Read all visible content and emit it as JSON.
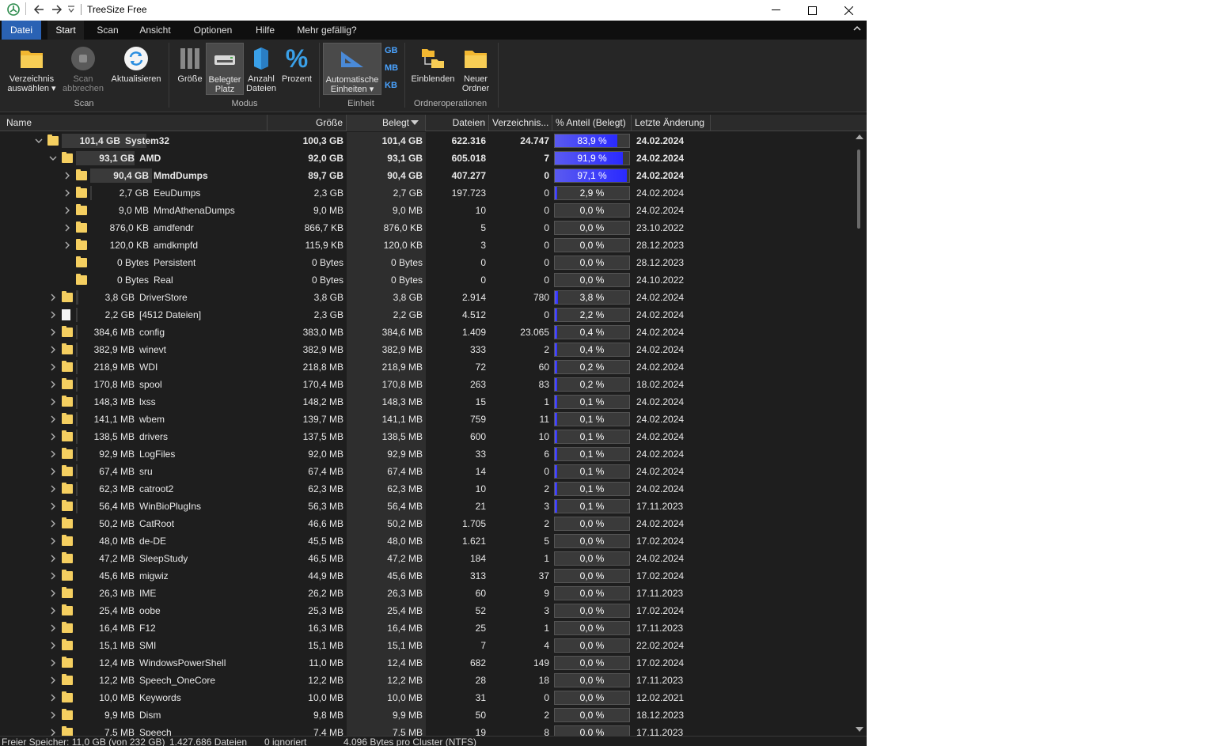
{
  "window": {
    "title": "TreeSize Free"
  },
  "tabs": [
    {
      "label": "Datei"
    },
    {
      "label": "Start"
    },
    {
      "label": "Scan"
    },
    {
      "label": "Ansicht"
    },
    {
      "label": "Optionen"
    },
    {
      "label": "Hilfe"
    },
    {
      "label": "Mehr gefällig?"
    }
  ],
  "ribbon": {
    "scan_group": {
      "label": "Scan",
      "select_dir": "Verzeichnis auswählen ▾",
      "select_dir_l1": "Verzeichnis",
      "select_dir_l2": "auswählen ▾",
      "abort_l1": "Scan",
      "abort_l2": "abbrechen",
      "refresh": "Aktualisieren"
    },
    "mode_group": {
      "label": "Modus",
      "size": "Größe",
      "used_l1": "Belegter",
      "used_l2": "Platz",
      "count_l1": "Anzahl",
      "count_l2": "Dateien",
      "percent": "Prozent"
    },
    "unit_group": {
      "label": "Einheit",
      "auto_l1": "Automatische",
      "auto_l2": "Einheiten ▾",
      "gb": "GB",
      "mb": "MB",
      "kb": "KB"
    },
    "folder_group": {
      "label": "Ordneroperationen",
      "show": "Einblenden",
      "new_l1": "Neuer",
      "new_l2": "Ordner"
    }
  },
  "columns": {
    "name": "Name",
    "size": "Größe",
    "used": "Belegt",
    "files": "Dateien",
    "dirs": "Verzeichnis...",
    "pct": "% Anteil (Belegt)",
    "modified": "Letzte Änderung"
  },
  "accent_color": "#2a62b4",
  "bar_color": "#3a3aff",
  "rows": [
    {
      "level": 0,
      "exp": "open",
      "type": "folder",
      "sz": "101,4 GB",
      "name": "System32",
      "size": "100,3 GB",
      "used": "101,4 GB",
      "files": "622.316",
      "dirs": "24.747",
      "pct": "83,9 %",
      "pv": 83.9,
      "date": "24.02.2024",
      "bold": true
    },
    {
      "level": 1,
      "exp": "open",
      "type": "folder",
      "sz": "93,1 GB",
      "name": "AMD",
      "size": "92,0 GB",
      "used": "93,1 GB",
      "files": "605.018",
      "dirs": "7",
      "pct": "91,9 %",
      "pv": 91.9,
      "date": "24.02.2024",
      "bold": true
    },
    {
      "level": 2,
      "exp": "closed",
      "type": "folder",
      "sz": "90,4 GB",
      "name": "MmdDumps",
      "size": "89,7 GB",
      "used": "90,4 GB",
      "files": "407.277",
      "dirs": "0",
      "pct": "97,1 %",
      "pv": 97.1,
      "date": "24.02.2024",
      "bold": true
    },
    {
      "level": 2,
      "exp": "closed",
      "type": "folder",
      "sz": "2,7 GB",
      "name": "EeuDumps",
      "size": "2,3 GB",
      "used": "2,7 GB",
      "files": "197.723",
      "dirs": "0",
      "pct": "2,9 %",
      "pv": 2.9,
      "date": "24.02.2024"
    },
    {
      "level": 2,
      "exp": "closed",
      "type": "folder",
      "sz": "9,0 MB",
      "name": "MmdAthenaDumps",
      "size": "9,0 MB",
      "used": "9,0 MB",
      "files": "10",
      "dirs": "0",
      "pct": "0,0 %",
      "pv": 0,
      "date": "24.02.2024"
    },
    {
      "level": 2,
      "exp": "closed",
      "type": "folder",
      "sz": "876,0 KB",
      "name": "amdfendr",
      "size": "866,7 KB",
      "used": "876,0 KB",
      "files": "5",
      "dirs": "0",
      "pct": "0,0 %",
      "pv": 0,
      "date": "23.10.2022"
    },
    {
      "level": 2,
      "exp": "closed",
      "type": "folder",
      "sz": "120,0 KB",
      "name": "amdkmpfd",
      "size": "115,9 KB",
      "used": "120,0 KB",
      "files": "3",
      "dirs": "0",
      "pct": "0,0 %",
      "pv": 0,
      "date": "28.12.2023"
    },
    {
      "level": 2,
      "exp": "none",
      "type": "folder",
      "sz": "0 Bytes",
      "name": "Persistent",
      "size": "0 Bytes",
      "used": "0 Bytes",
      "files": "0",
      "dirs": "0",
      "pct": "0,0 %",
      "pv": 0,
      "date": "28.12.2023"
    },
    {
      "level": 2,
      "exp": "none",
      "type": "folder",
      "sz": "0 Bytes",
      "name": "Real",
      "size": "0 Bytes",
      "used": "0 Bytes",
      "files": "0",
      "dirs": "0",
      "pct": "0,0 %",
      "pv": 0,
      "date": "24.10.2022"
    },
    {
      "level": 1,
      "exp": "closed",
      "type": "folder",
      "sz": "3,8 GB",
      "name": "DriverStore",
      "size": "3,8 GB",
      "used": "3,8 GB",
      "files": "2.914",
      "dirs": "780",
      "pct": "3,8 %",
      "pv": 3.8,
      "date": "24.02.2024"
    },
    {
      "level": 1,
      "exp": "closed",
      "type": "file",
      "sz": "2,2 GB",
      "name": "[4512 Dateien]",
      "size": "2,3 GB",
      "used": "2,2 GB",
      "files": "4.512",
      "dirs": "0",
      "pct": "2,2 %",
      "pv": 2.2,
      "date": "24.02.2024"
    },
    {
      "level": 1,
      "exp": "closed",
      "type": "folder",
      "sz": "384,6 MB",
      "name": "config",
      "size": "383,0 MB",
      "used": "384,6 MB",
      "files": "1.409",
      "dirs": "23.065",
      "pct": "0,4 %",
      "pv": 0.4,
      "date": "24.02.2024"
    },
    {
      "level": 1,
      "exp": "closed",
      "type": "folder",
      "sz": "382,9 MB",
      "name": "winevt",
      "size": "382,9 MB",
      "used": "382,9 MB",
      "files": "333",
      "dirs": "2",
      "pct": "0,4 %",
      "pv": 0.4,
      "date": "24.02.2024"
    },
    {
      "level": 1,
      "exp": "closed",
      "type": "folder",
      "sz": "218,9 MB",
      "name": "WDI",
      "size": "218,8 MB",
      "used": "218,9 MB",
      "files": "72",
      "dirs": "60",
      "pct": "0,2 %",
      "pv": 0.2,
      "date": "24.02.2024"
    },
    {
      "level": 1,
      "exp": "closed",
      "type": "folder",
      "sz": "170,8 MB",
      "name": "spool",
      "size": "170,4 MB",
      "used": "170,8 MB",
      "files": "263",
      "dirs": "83",
      "pct": "0,2 %",
      "pv": 0.2,
      "date": "18.02.2024"
    },
    {
      "level": 1,
      "exp": "closed",
      "type": "folder",
      "sz": "148,3 MB",
      "name": "lxss",
      "size": "148,2 MB",
      "used": "148,3 MB",
      "files": "15",
      "dirs": "1",
      "pct": "0,1 %",
      "pv": 0.1,
      "date": "24.02.2024"
    },
    {
      "level": 1,
      "exp": "closed",
      "type": "folder",
      "sz": "141,1 MB",
      "name": "wbem",
      "size": "139,7 MB",
      "used": "141,1 MB",
      "files": "759",
      "dirs": "11",
      "pct": "0,1 %",
      "pv": 0.1,
      "date": "24.02.2024"
    },
    {
      "level": 1,
      "exp": "closed",
      "type": "folder",
      "sz": "138,5 MB",
      "name": "drivers",
      "size": "137,5 MB",
      "used": "138,5 MB",
      "files": "600",
      "dirs": "10",
      "pct": "0,1 %",
      "pv": 0.1,
      "date": "24.02.2024"
    },
    {
      "level": 1,
      "exp": "closed",
      "type": "folder",
      "sz": "92,9 MB",
      "name": "LogFiles",
      "size": "92,0 MB",
      "used": "92,9 MB",
      "files": "33",
      "dirs": "6",
      "pct": "0,1 %",
      "pv": 0.1,
      "date": "24.02.2024"
    },
    {
      "level": 1,
      "exp": "closed",
      "type": "folder",
      "sz": "67,4 MB",
      "name": "sru",
      "size": "67,4 MB",
      "used": "67,4 MB",
      "files": "14",
      "dirs": "0",
      "pct": "0,1 %",
      "pv": 0.1,
      "date": "24.02.2024"
    },
    {
      "level": 1,
      "exp": "closed",
      "type": "folder",
      "sz": "62,3 MB",
      "name": "catroot2",
      "size": "62,3 MB",
      "used": "62,3 MB",
      "files": "10",
      "dirs": "2",
      "pct": "0,1 %",
      "pv": 0.1,
      "date": "24.02.2024"
    },
    {
      "level": 1,
      "exp": "closed",
      "type": "folder",
      "sz": "56,4 MB",
      "name": "WinBioPlugIns",
      "size": "56,3 MB",
      "used": "56,4 MB",
      "files": "21",
      "dirs": "3",
      "pct": "0,1 %",
      "pv": 0.1,
      "date": "17.11.2023"
    },
    {
      "level": 1,
      "exp": "closed",
      "type": "folder",
      "sz": "50,2 MB",
      "name": "CatRoot",
      "size": "46,6 MB",
      "used": "50,2 MB",
      "files": "1.705",
      "dirs": "2",
      "pct": "0,0 %",
      "pv": 0,
      "date": "24.02.2024"
    },
    {
      "level": 1,
      "exp": "closed",
      "type": "folder",
      "sz": "48,0 MB",
      "name": "de-DE",
      "size": "45,5 MB",
      "used": "48,0 MB",
      "files": "1.621",
      "dirs": "5",
      "pct": "0,0 %",
      "pv": 0,
      "date": "17.02.2024"
    },
    {
      "level": 1,
      "exp": "closed",
      "type": "folder",
      "sz": "47,2 MB",
      "name": "SleepStudy",
      "size": "46,5 MB",
      "used": "47,2 MB",
      "files": "184",
      "dirs": "1",
      "pct": "0,0 %",
      "pv": 0,
      "date": "24.02.2024"
    },
    {
      "level": 1,
      "exp": "closed",
      "type": "folder",
      "sz": "45,6 MB",
      "name": "migwiz",
      "size": "44,9 MB",
      "used": "45,6 MB",
      "files": "313",
      "dirs": "37",
      "pct": "0,0 %",
      "pv": 0,
      "date": "17.02.2024"
    },
    {
      "level": 1,
      "exp": "closed",
      "type": "folder",
      "sz": "26,3 MB",
      "name": "IME",
      "size": "26,2 MB",
      "used": "26,3 MB",
      "files": "60",
      "dirs": "9",
      "pct": "0,0 %",
      "pv": 0,
      "date": "17.11.2023"
    },
    {
      "level": 1,
      "exp": "closed",
      "type": "folder",
      "sz": "25,4 MB",
      "name": "oobe",
      "size": "25,3 MB",
      "used": "25,4 MB",
      "files": "52",
      "dirs": "3",
      "pct": "0,0 %",
      "pv": 0,
      "date": "17.02.2024"
    },
    {
      "level": 1,
      "exp": "closed",
      "type": "folder",
      "sz": "16,4 MB",
      "name": "F12",
      "size": "16,3 MB",
      "used": "16,4 MB",
      "files": "25",
      "dirs": "1",
      "pct": "0,0 %",
      "pv": 0,
      "date": "17.11.2023"
    },
    {
      "level": 1,
      "exp": "closed",
      "type": "folder",
      "sz": "15,1 MB",
      "name": "SMI",
      "size": "15,1 MB",
      "used": "15,1 MB",
      "files": "7",
      "dirs": "4",
      "pct": "0,0 %",
      "pv": 0,
      "date": "22.02.2024"
    },
    {
      "level": 1,
      "exp": "closed",
      "type": "folder",
      "sz": "12,4 MB",
      "name": "WindowsPowerShell",
      "size": "11,0 MB",
      "used": "12,4 MB",
      "files": "682",
      "dirs": "149",
      "pct": "0,0 %",
      "pv": 0,
      "date": "17.02.2024"
    },
    {
      "level": 1,
      "exp": "closed",
      "type": "folder",
      "sz": "12,2 MB",
      "name": "Speech_OneCore",
      "size": "12,2 MB",
      "used": "12,2 MB",
      "files": "28",
      "dirs": "18",
      "pct": "0,0 %",
      "pv": 0,
      "date": "17.11.2023"
    },
    {
      "level": 1,
      "exp": "closed",
      "type": "folder",
      "sz": "10,0 MB",
      "name": "Keywords",
      "size": "10,0 MB",
      "used": "10,0 MB",
      "files": "31",
      "dirs": "0",
      "pct": "0,0 %",
      "pv": 0,
      "date": "12.02.2021"
    },
    {
      "level": 1,
      "exp": "closed",
      "type": "folder",
      "sz": "9,9 MB",
      "name": "Dism",
      "size": "9,8 MB",
      "used": "9,9 MB",
      "files": "50",
      "dirs": "2",
      "pct": "0,0 %",
      "pv": 0,
      "date": "18.12.2023"
    },
    {
      "level": 1,
      "exp": "closed",
      "type": "folder",
      "sz": "7,5 MB",
      "name": "Speech",
      "size": "7,4 MB",
      "used": "7,5 MB",
      "files": "19",
      "dirs": "8",
      "pct": "0,0 %",
      "pv": 0,
      "date": "17.11.2023"
    }
  ],
  "status": {
    "free": "Freier Speicher: 11,0 GB  (von 232 GB)",
    "files": "1.427.686 Dateien",
    "ignored": "0 ignoriert",
    "cluster": "4.096 Bytes pro Cluster (NTFS)"
  }
}
